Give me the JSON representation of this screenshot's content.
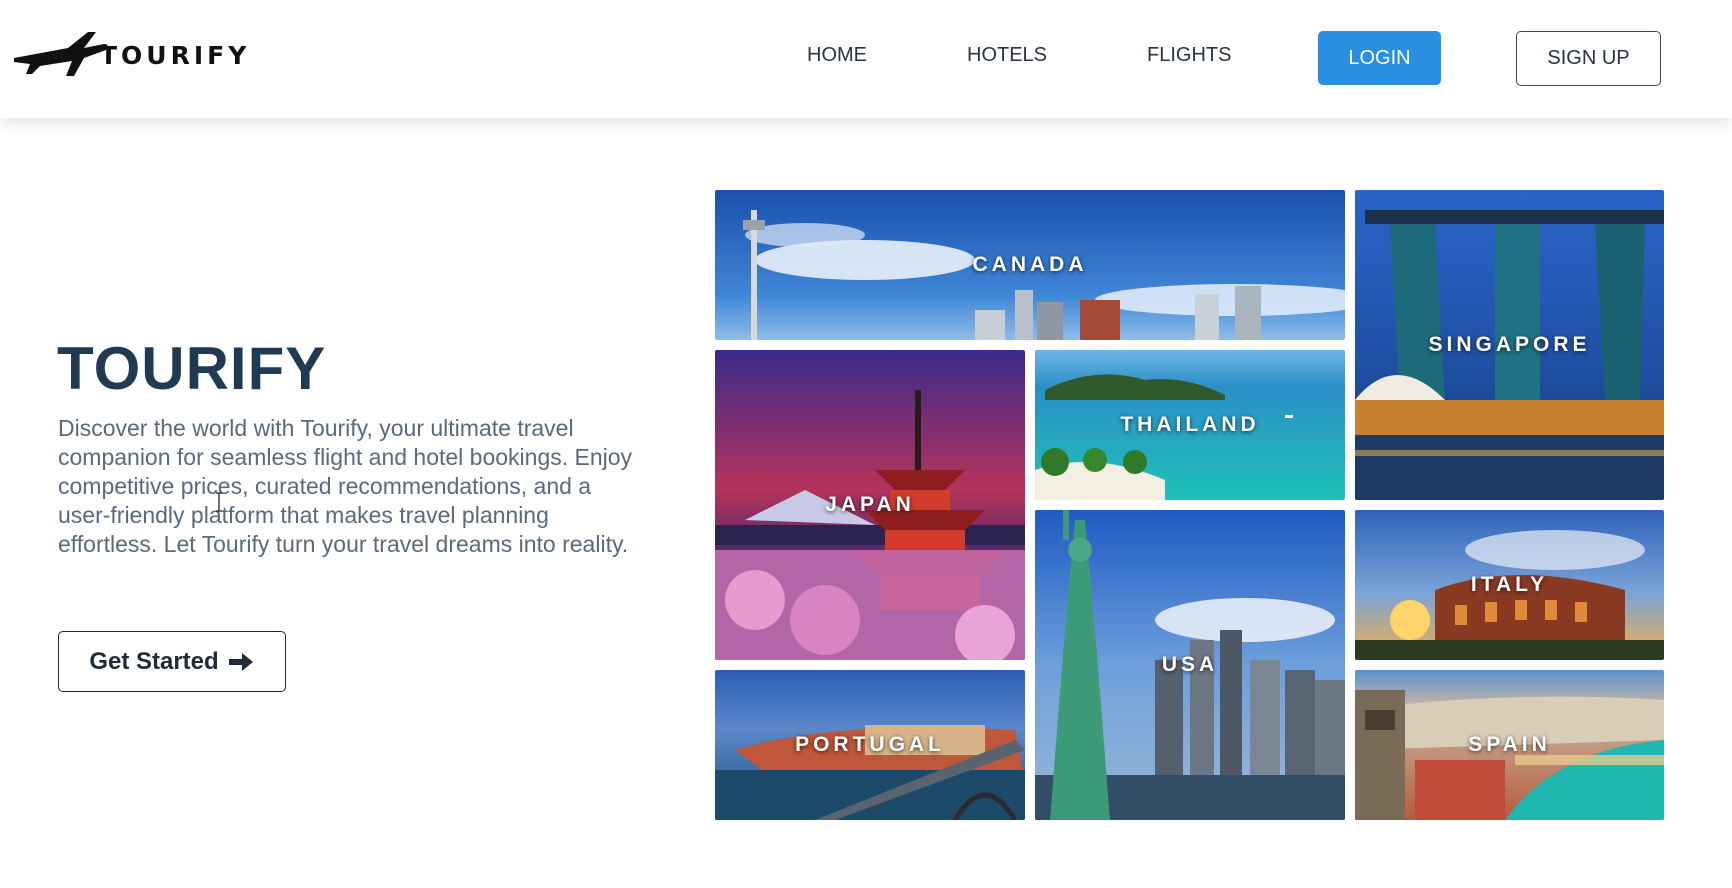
{
  "brand": {
    "logo_text": "TOURIFY",
    "logo_icon": "airplane-icon"
  },
  "nav": {
    "home": "HOME",
    "hotels": "HOTELS",
    "flights": "FLIGHTS",
    "login": "LOGIN",
    "signup": "SIGN UP"
  },
  "hero": {
    "title": "TOURIFY",
    "description": "Discover the world with Tourify, your ultimate travel companion for seamless flight and hotel bookings. Enjoy competitive prices, curated recommendations, and a user-friendly platform that makes travel planning effortless. Let Tourify turn your travel dreams into reality.",
    "cta_label": "Get Started",
    "cta_icon": "arrow-right-icon"
  },
  "destinations": [
    {
      "label": "CANADA"
    },
    {
      "label": "SINGAPORE"
    },
    {
      "label": "JAPAN"
    },
    {
      "label": "THAILAND"
    },
    {
      "label": "USA"
    },
    {
      "label": "ITALY"
    },
    {
      "label": "PORTUGAL"
    },
    {
      "label": "SPAIN"
    }
  ],
  "colors": {
    "accent": "#2a8fe0",
    "heading": "#1f3a52",
    "body_text": "#5a6a7d"
  }
}
